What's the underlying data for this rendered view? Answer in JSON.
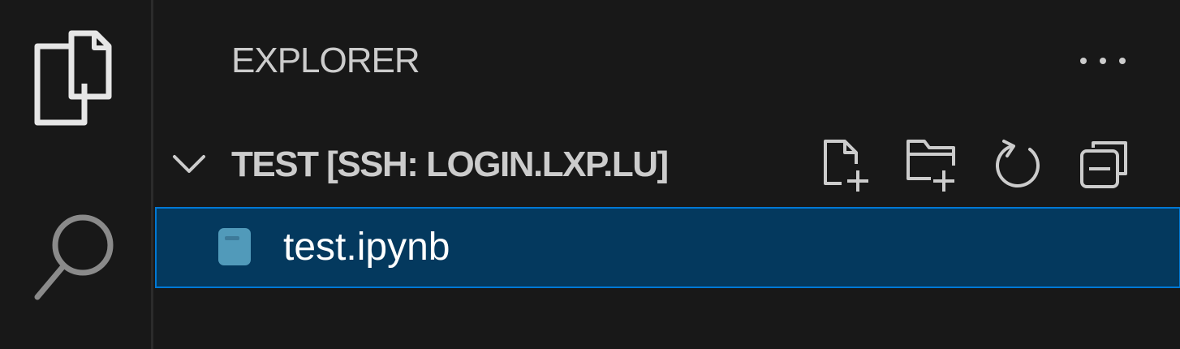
{
  "sidebar": {
    "header": {
      "title": "EXPLORER",
      "more_label": "..."
    },
    "folder": {
      "label": "TEST [SSH: LOGIN.LXP.LU]",
      "expanded": true,
      "actions": [
        {
          "icon": "new-file-icon"
        },
        {
          "icon": "new-folder-icon"
        },
        {
          "icon": "refresh-icon"
        },
        {
          "icon": "collapse-all-icon"
        }
      ]
    },
    "files": [
      {
        "name": "test.ipynb",
        "icon": "notebook-icon",
        "selected": true
      }
    ]
  },
  "activity_bar": {
    "items": [
      {
        "icon": "files-icon",
        "active": true
      },
      {
        "icon": "search-icon",
        "active": false
      }
    ]
  },
  "colors": {
    "background": "#181818",
    "selection": "#04395e",
    "focus_border": "#0078d4",
    "notebook_icon": "#519aba"
  }
}
